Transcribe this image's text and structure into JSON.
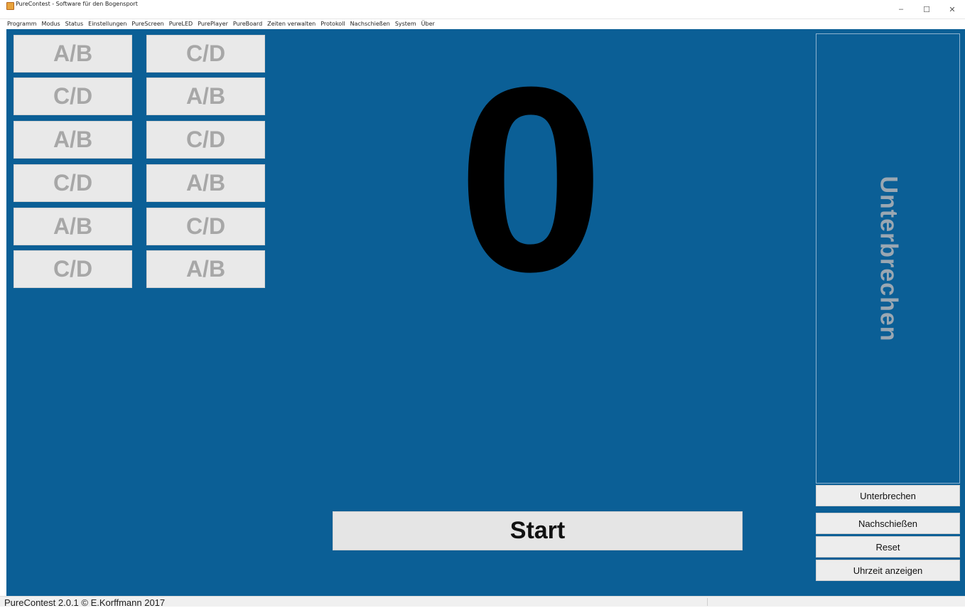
{
  "window": {
    "title": "PureContest - Software für den Bogensport",
    "controls": {
      "minimize": "–",
      "maximize": "☐",
      "close": "✕"
    },
    "app_icon": "target-icon"
  },
  "menu": [
    "Programm",
    "Modus",
    "Status",
    "Einstellungen",
    "PureScreen",
    "PureLED",
    "PurePlayer",
    "PureBoard",
    "Zeiten verwalten",
    "Protokoll",
    "Nachschießen",
    "System",
    "Über"
  ],
  "groups": {
    "left": [
      "A/B",
      "C/D",
      "A/B",
      "C/D",
      "A/B",
      "C/D"
    ],
    "right": [
      "C/D",
      "A/B",
      "C/D",
      "A/B",
      "C/D",
      "A/B"
    ]
  },
  "counter": "0",
  "start_label": "Start",
  "side": {
    "vertical_label": "Unterbrechen",
    "buttons": [
      "Unterbrechen",
      "Nachschießen",
      "Reset",
      "Uhrzeit anzeigen"
    ]
  },
  "status": {
    "text": "PureContest 2.0.1 © E.Korffmann 2017"
  },
  "colors": {
    "main_background": "#0b5f96",
    "button_background": "#e9e9e9",
    "group_text": "#a7a7a7",
    "counter": "#000000"
  }
}
